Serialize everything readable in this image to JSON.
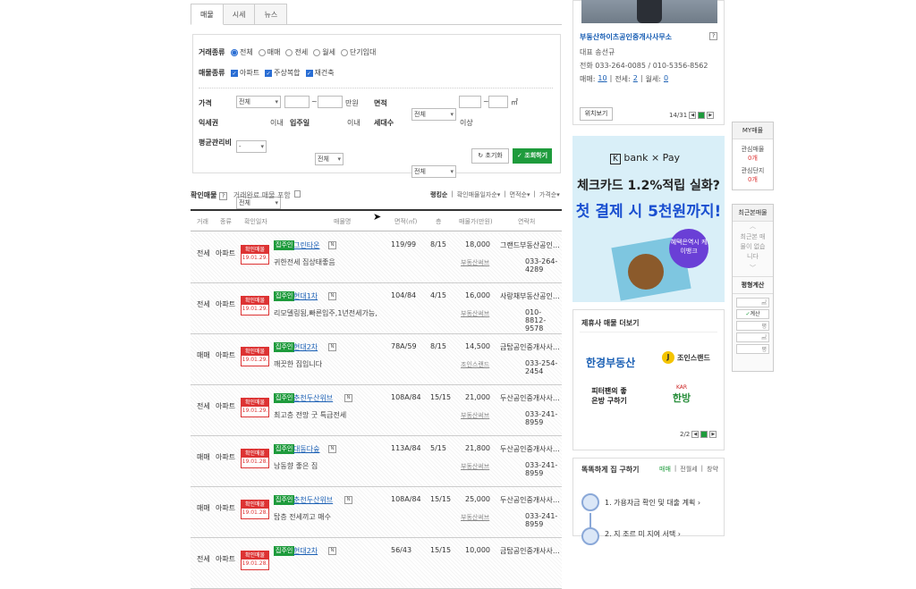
{
  "tabs": [
    "매물",
    "시세",
    "뉴스"
  ],
  "filter": {
    "deal_label": "거래종류",
    "deal_options": [
      "전체",
      "매매",
      "전세",
      "월세",
      "단기임대"
    ],
    "type_label": "매물종류",
    "type_options": [
      "아파트",
      "주상복합",
      "재건축"
    ],
    "price_label": "가격",
    "price_unit": "만원",
    "area_label": "면적",
    "area_unit": "㎡",
    "yield_label": "익세권",
    "yield_sel": "-",
    "within": "이내",
    "move_label": "입주일",
    "move_sel": "전체",
    "households_label": "세대수",
    "above": "이상",
    "mgmt_label": "평균관리비",
    "all": "전체",
    "reset_btn": "초기화",
    "search_btn": "조회하기"
  },
  "list": {
    "title": "확인매물",
    "help": "?",
    "include_done": "거래완료 매물 포함",
    "sorts": [
      "랭킹순",
      "확인매물일자순",
      "면적순",
      "가격순"
    ],
    "headers": [
      "거래",
      "종류",
      "확인일자",
      "매물명",
      "면적(㎡)",
      "층",
      "매물가(만원)",
      "연락처"
    ],
    "rows": [
      {
        "deal": "전세",
        "type": "아파트",
        "stamp": "확인매물",
        "date": "19.01.29.",
        "badge": "집주인",
        "name": "그린타운",
        "desc": "귀한전세 집상태좋음",
        "area": "119/99",
        "floor": "8/15",
        "price": "18,000",
        "src": "부동산써브",
        "agency": "그랜드부동산공인…",
        "phone": "033-264-4289"
      },
      {
        "deal": "전세",
        "type": "아파트",
        "stamp": "확인매물",
        "date": "19.01.29.",
        "badge": "집주인",
        "name": "현대1차",
        "desc": "리모델링됨,빠른입주,1년전세가능,",
        "area": "104/84",
        "floor": "4/15",
        "price": "16,000",
        "src": "부동산써브",
        "agency": "사랑채부동산공인…",
        "phone": "010-8812-9578"
      },
      {
        "deal": "매매",
        "type": "아파트",
        "stamp": "확인매물",
        "date": "19.01.29.",
        "badge": "집주인",
        "name": "현대2차",
        "desc": "깨끗한 집입니다",
        "area": "78A/59",
        "floor": "8/15",
        "price": "14,500",
        "src": "조인스랜드",
        "agency": "금탑공인중개사사…",
        "phone": "033-254-2454"
      },
      {
        "deal": "전세",
        "type": "아파트",
        "stamp": "확인매물",
        "date": "19.01.29.",
        "badge": "집주인",
        "name": "춘천두산위브",
        "desc": "최고층 전망 굿 특급전세",
        "area": "108A/84",
        "floor": "15/15",
        "price": "21,000",
        "src": "부동산써브",
        "agency": "두산공인중개사사…",
        "phone": "033-241-8959"
      },
      {
        "deal": "매매",
        "type": "아파트",
        "stamp": "확인매물",
        "date": "19.01.28.",
        "badge": "집주인",
        "name": "대동다숲",
        "desc": "남동향 좋은 집",
        "area": "113A/84",
        "floor": "5/15",
        "price": "21,800",
        "src": "부동산써브",
        "agency": "두산공인중개사사…",
        "phone": "033-241-8959"
      },
      {
        "deal": "매매",
        "type": "아파트",
        "stamp": "확인매물",
        "date": "19.01.28.",
        "badge": "집주인",
        "name": "춘천두산위브",
        "desc": "탑층 전세끼고 매수",
        "area": "108A/84",
        "floor": "15/15",
        "price": "25,000",
        "src": "부동산써브",
        "agency": "두산공인중개사사…",
        "phone": "033-241-8959"
      },
      {
        "deal": "전세",
        "type": "아파트",
        "stamp": "확인매물",
        "date": "19.01.28.",
        "badge": "집주인",
        "name": "현대2차",
        "desc": "",
        "area": "56/43",
        "floor": "15/15",
        "price": "10,000",
        "src": "",
        "agency": "금탑공인중개사사…",
        "phone": ""
      }
    ]
  },
  "agent": {
    "name": "부동산하이츠공인중개사사무소",
    "help": "?",
    "rep": "대표 송선규",
    "phone": "전화 033-264-0085 / 010-5356-8562",
    "sale_label": "매매:",
    "sale": "10",
    "jeonse_label": "전세:",
    "jeonse": "2",
    "monthly_label": "월세:",
    "monthly": "0",
    "map_btn": "위치보기",
    "page": "14/31"
  },
  "ad": {
    "brand": "bank × Pay",
    "line1": "체크카드 1.2%적립 실화?",
    "line2": "첫 결제 시 5천원까지!",
    "bubble": "혜택은역시 케이뱅크"
  },
  "partner": {
    "title": "제휴사 매물 더보기",
    "logos": [
      "한경부동산",
      "조인스랜드",
      "피터팬의 좋은방 구하기",
      "한방"
    ],
    "page": "2/2"
  },
  "smart": {
    "title": "똑똑하게 집 구하기",
    "tabs": [
      "매매",
      "전월세",
      "창약"
    ],
    "step1": "1. 가용자금 확인 및 대출 계획 ›",
    "step2": "2. 지 조르 미 지여 서택 ›"
  },
  "side": {
    "my": "MY매물",
    "fav_items": "관심매물",
    "fav_items_n": "0개",
    "fav_complex": "관심단지",
    "fav_complex_n": "0개",
    "recent": "최근본매물",
    "recent_empty": "최근본 매물이 없습니다",
    "calc": "평형계산",
    "calc_btn": "계산"
  }
}
